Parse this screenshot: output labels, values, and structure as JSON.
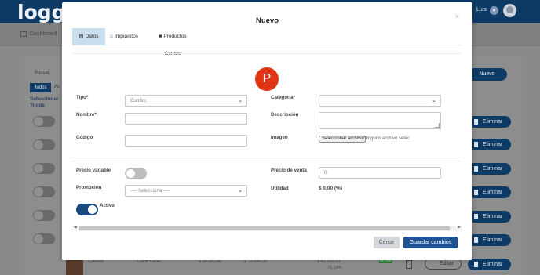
{
  "background": {
    "logo": "loggr",
    "user_name": "Luis",
    "nav_dashboard": "Dashboard",
    "search_label": "Buscar:",
    "new_button": "Nuevo",
    "tab_all": "Todos",
    "tab_partial": "Ac",
    "select_all_header": "Seleccionar Todos",
    "delete_label": "Eliminar",
    "edit_label": "Editar",
    "last_row": {
      "name": "Collares",
      "code": "Collar Lucia",
      "price1": "$ 35.000,00",
      "price2": "$ 12.000,00",
      "price3": "$ 43.000,00",
      "percent": "78,18%",
      "badge": "ACTIVO"
    }
  },
  "modal": {
    "title": "Nuevo",
    "close_icon": "×",
    "tabs": [
      {
        "label": "Datos",
        "icon": "doc-icon"
      },
      {
        "label": "Impuestos",
        "icon": "bank-icon"
      },
      {
        "label": "Productos Combo",
        "icon": "lock-icon"
      }
    ],
    "avatar_letter": "P",
    "avatar_color": "#e03414",
    "fields": {
      "tipo_label": "Tipo*",
      "tipo_value": "Combo",
      "nombre_label": "Nombre*",
      "codigo_label": "Código",
      "categoria_label": "Categoria*",
      "descripcion_label": "Descripción",
      "imagen_label": "Imagen",
      "file_button": "Seleccionar archivo",
      "file_text": "Ninguno archivo selec.",
      "precio_variable_label": "Precio variable",
      "promocion_label": "Promoción",
      "promocion_value": "---- Selecciona ----",
      "activo_label": "Activo",
      "precio_venta_label": "Precio de venta",
      "precio_venta_value": "0",
      "utilidad_label": "Utilidad",
      "utilidad_value": "$ 0,00 (%)"
    },
    "precio_variable_on": false,
    "activo_on": true,
    "buttons": {
      "close": "Cerrar",
      "save": "Guardar cambios"
    },
    "primary_color": "#1d5394"
  }
}
